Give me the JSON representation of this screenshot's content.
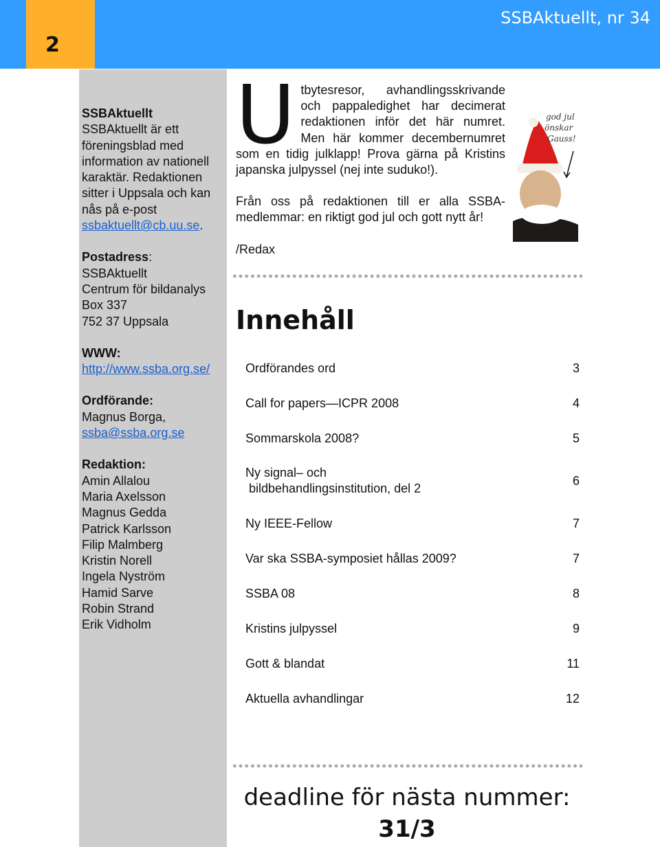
{
  "header": {
    "page_number": "2",
    "title": "SSBAktuellt, nr 34"
  },
  "sidebar": {
    "about_heading": "SSBAktuellt",
    "about_text": "SSBAktuellt är ett föreningsblad med information av nationell karaktär. Redaktionen sitter i Uppsala och kan nås på e-post ",
    "about_email": "ssbaktuellt@cb.uu.se",
    "postal_heading": "Postadress",
    "postal_lines": [
      "SSBAktuellt",
      "Centrum för bildanalys",
      "Box 337",
      "752 37 Uppsala"
    ],
    "www_heading": "WWW:",
    "www_link": "http://www.ssba.org.se/",
    "chair_heading": "Ordförande:",
    "chair_name": "Magnus Borga,",
    "chair_email": "ssba@ssba.org.se",
    "editors_heading": "Redaktion:",
    "editors": [
      "Amin Allalou",
      "Maria Axelsson",
      "Magnus Gedda",
      "Patrick Karlsson",
      "Filip Malmberg",
      "Kristin Norell",
      "Ingela Nyström",
      "Hamid Sarve",
      "Robin Strand",
      "Erik Vidholm"
    ]
  },
  "intro": {
    "drop_cap": "U",
    "text1": "tbytesresor, avhandlingsskrivande och pappaledighet har decimerat redaktionen inför det här numret. Men här kommer decembernumret som en tidig julklapp! Prova gärna på Kristins japanska julpyssel (nej inte suduko!).",
    "text2": "Från oss på redaktionen till er alla SSBA-medlemmar: en riktigt god jul och gott nytt år!",
    "signature": "/Redax",
    "image_caption": "god jul önskar Gauss!"
  },
  "toc": {
    "title": "Innehåll",
    "items": [
      {
        "label": "Ordförandes ord",
        "page": "3"
      },
      {
        "label": "Call for papers—ICPR 2008",
        "page": "4"
      },
      {
        "label": "Sommarskola 2008?",
        "page": "5"
      },
      {
        "label": "Ny signal– och\n bildbehandlingsinstitution, del 2",
        "page": "6"
      },
      {
        "label": "Ny IEEE-Fellow",
        "page": "7"
      },
      {
        "label": "Var ska SSBA-symposiet hållas 2009?",
        "page": "7"
      },
      {
        "label": "SSBA 08",
        "page": "8"
      },
      {
        "label": "Kristins julpyssel",
        "page": "9"
      },
      {
        "label": "Gott & blandat",
        "page": "11"
      },
      {
        "label": "Aktuella avhandlingar",
        "page": "12"
      }
    ]
  },
  "deadline": {
    "text": "deadline för nästa nummer:",
    "date": "31/3"
  },
  "colors": {
    "header": "#339cff",
    "page_tab": "#ffb02a",
    "sidebar": "#cdcdcd"
  }
}
